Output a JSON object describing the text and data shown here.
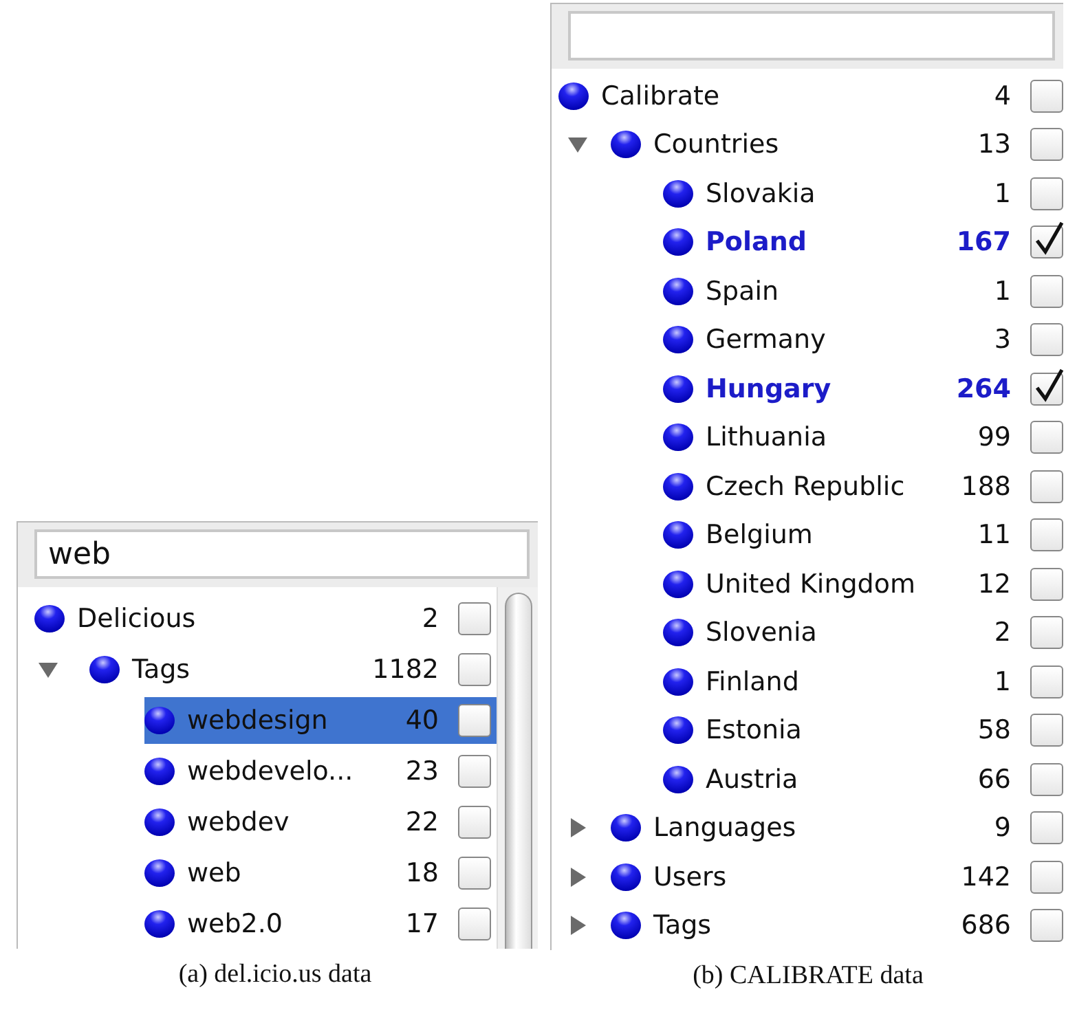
{
  "figures": [
    {
      "search": {
        "value": "web"
      },
      "scrollbar": true,
      "caption": "(a) del.icio.us data",
      "tree": [
        {
          "name": "Delicious",
          "count": "2",
          "checked": false,
          "selected": false
        },
        {
          "name": "Tags",
          "count": "1182",
          "checked": false,
          "selected": false,
          "expanded": true,
          "children": [
            {
              "name": "webdesign",
              "count": "40",
              "checked": false,
              "selected": true
            },
            {
              "name": "webdevelo...",
              "count": "23",
              "checked": false,
              "selected": false
            },
            {
              "name": "webdev",
              "count": "22",
              "checked": false,
              "selected": false
            },
            {
              "name": "web",
              "count": "18",
              "checked": false,
              "selected": false
            },
            {
              "name": "web2.0",
              "count": "17",
              "checked": false,
              "selected": false
            }
          ]
        }
      ]
    },
    {
      "scrollbar": false,
      "caption": "(b) CALIBRATE data",
      "tree": [
        {
          "name": "Calibrate",
          "count": "4",
          "checked": false,
          "selected": false
        },
        {
          "name": "Countries",
          "count": "13",
          "checked": false,
          "selected": false,
          "expanded": true,
          "children": [
            {
              "name": "Slovakia",
              "count": "1",
              "checked": false,
              "selected": false
            },
            {
              "name": "Poland",
              "count": "167",
              "checked": true,
              "selected": false
            },
            {
              "name": "Spain",
              "count": "1",
              "checked": false,
              "selected": false
            },
            {
              "name": "Germany",
              "count": "3",
              "checked": false,
              "selected": false
            },
            {
              "name": "Hungary",
              "count": "264",
              "checked": true,
              "selected": false
            },
            {
              "name": "Lithuania",
              "count": "99",
              "checked": false,
              "selected": false
            },
            {
              "name": "Czech Republic",
              "count": "188",
              "checked": false,
              "selected": false
            },
            {
              "name": "Belgium",
              "count": "11",
              "checked": false,
              "selected": false
            },
            {
              "name": "United Kingdom",
              "count": "12",
              "checked": false,
              "selected": false
            },
            {
              "name": "Slovenia",
              "count": "2",
              "checked": false,
              "selected": false
            },
            {
              "name": "Finland",
              "count": "1",
              "checked": false,
              "selected": false
            },
            {
              "name": "Estonia",
              "count": "58",
              "checked": false,
              "selected": false
            },
            {
              "name": "Austria",
              "count": "66",
              "checked": false,
              "selected": false
            }
          ]
        },
        {
          "name": "Languages",
          "count": "9",
          "checked": false,
          "selected": false,
          "expanded": false
        },
        {
          "name": "Users",
          "count": "142",
          "checked": false,
          "selected": false,
          "expanded": false
        },
        {
          "name": "Tags",
          "count": "686",
          "checked": false,
          "selected": false,
          "expanded": false
        }
      ]
    }
  ]
}
